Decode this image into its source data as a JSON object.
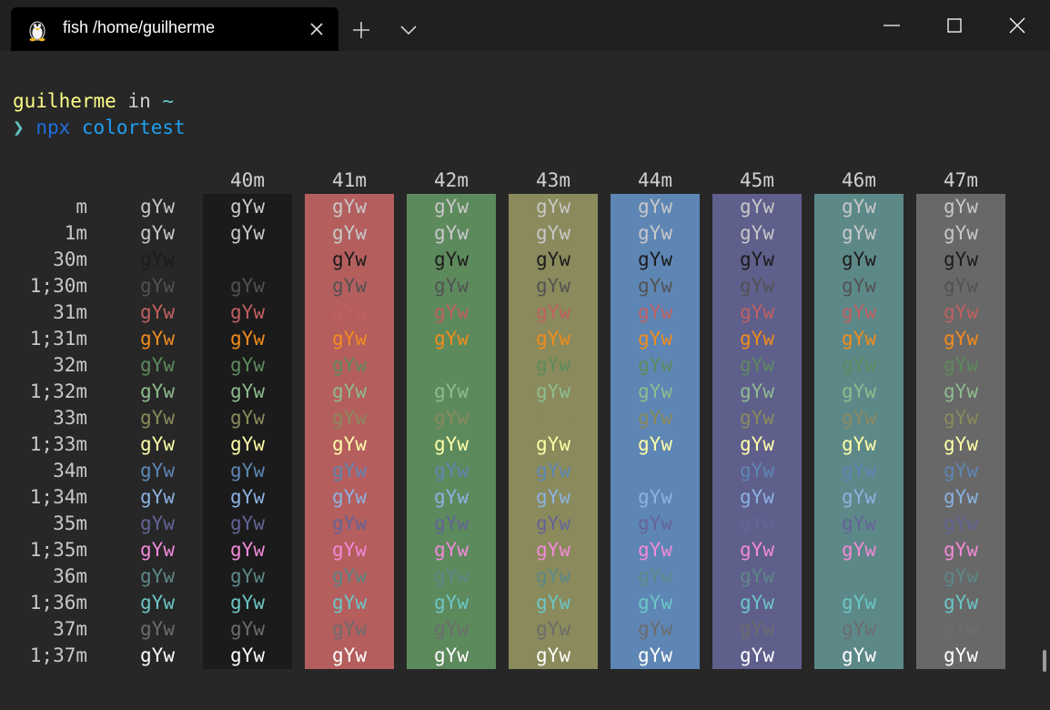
{
  "tab": {
    "title": "fish /home/guilherme",
    "icon": "linux-penguin-icon"
  },
  "prompt": {
    "user": "guilherme",
    "in": "in",
    "cwd": "~",
    "arrow": "❯",
    "command": "npx",
    "argument": "colortest"
  },
  "colortest": {
    "sample": "gYw",
    "columns": [
      {
        "label": "",
        "bg": null
      },
      {
        "label": "40m",
        "bg": "#1b1b1b"
      },
      {
        "label": "41m",
        "bg": "#b45e5e"
      },
      {
        "label": "42m",
        "bg": "#5d8a5d"
      },
      {
        "label": "43m",
        "bg": "#8a8a5c"
      },
      {
        "label": "44m",
        "bg": "#5e86b4"
      },
      {
        "label": "45m",
        "bg": "#5f5f8c"
      },
      {
        "label": "46m",
        "bg": "#5d8888"
      },
      {
        "label": "47m",
        "bg": "#686868"
      }
    ],
    "rows": [
      {
        "label": "m",
        "fg": "#c8c8c8"
      },
      {
        "label": "1m",
        "fg": "#c8c8c8"
      },
      {
        "label": "30m",
        "fg": "#1b1b1b"
      },
      {
        "label": "1;30m",
        "fg": "#525252"
      },
      {
        "label": "31m",
        "fg": "#c06060"
      },
      {
        "label": "1;31m",
        "fg": "#f28c1c"
      },
      {
        "label": "32m",
        "fg": "#5d8a5d"
      },
      {
        "label": "1;32m",
        "fg": "#8ebc8e"
      },
      {
        "label": "33m",
        "fg": "#8a8a5c"
      },
      {
        "label": "1;33m",
        "fg": "#ffffa8"
      },
      {
        "label": "34m",
        "fg": "#5e86b4"
      },
      {
        "label": "1;34m",
        "fg": "#8cb2e2"
      },
      {
        "label": "35m",
        "fg": "#646496"
      },
      {
        "label": "1;35m",
        "fg": "#f28ad8"
      },
      {
        "label": "36m",
        "fg": "#5d8888"
      },
      {
        "label": "1;36m",
        "fg": "#6cc6c6"
      },
      {
        "label": "37m",
        "fg": "#6c6c6c"
      },
      {
        "label": "1;37m",
        "fg": "#ffffff"
      }
    ]
  }
}
